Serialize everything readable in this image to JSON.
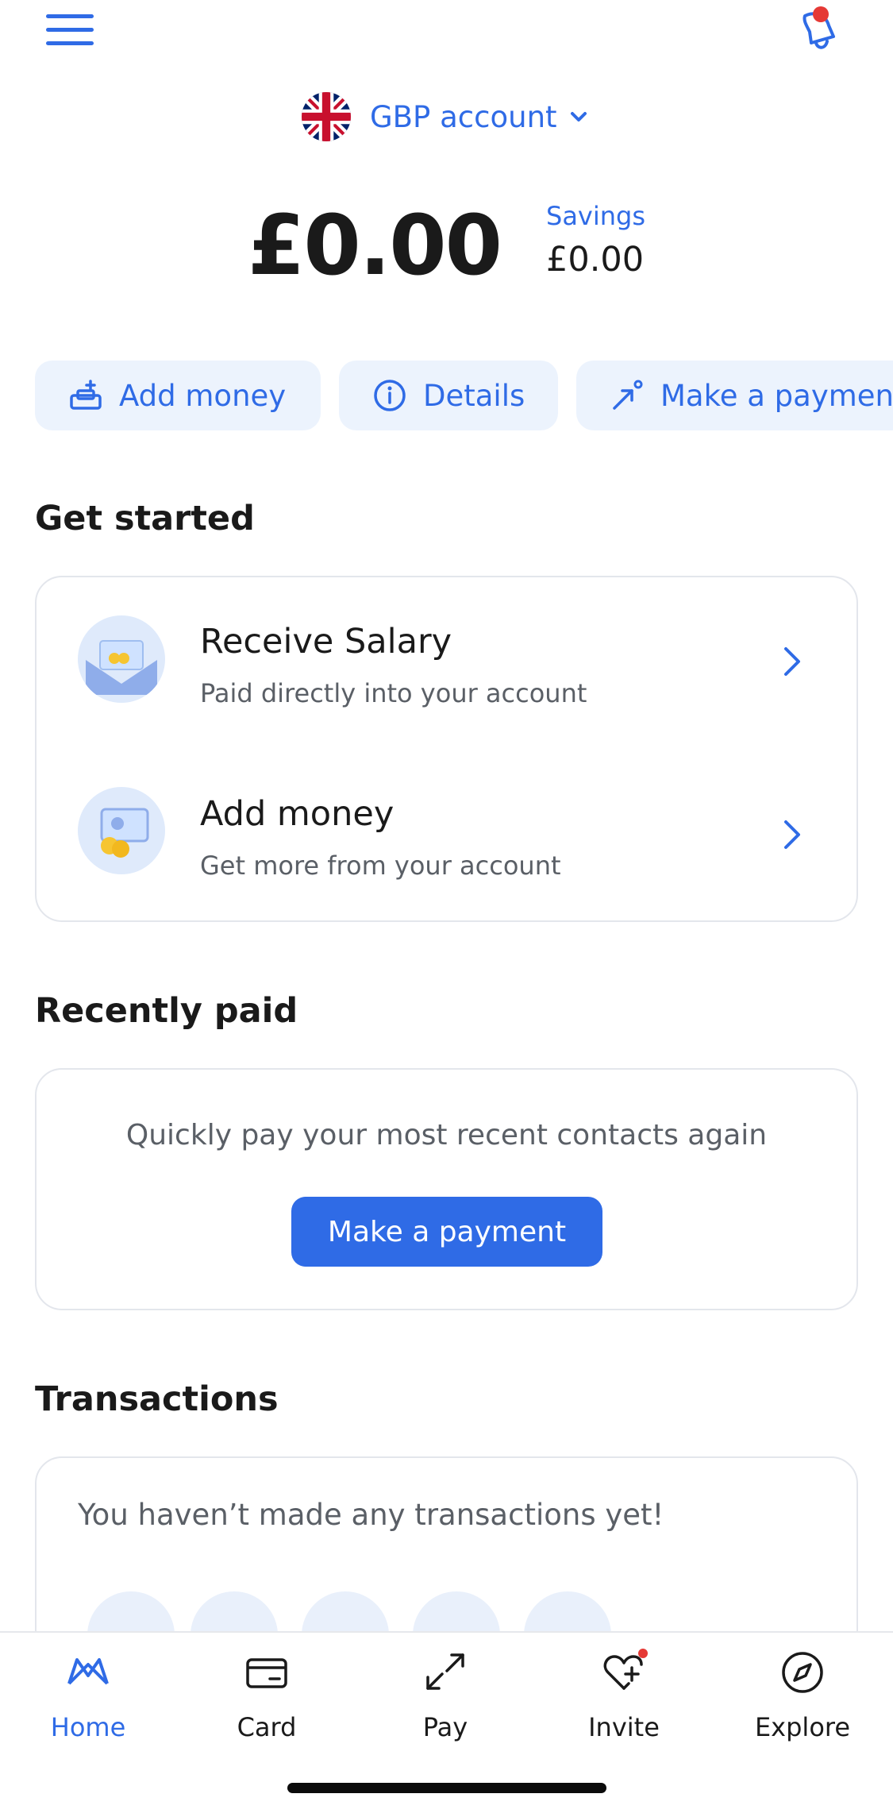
{
  "header": {
    "menu_icon": "hamburger-menu-icon",
    "notifications_icon": "bell-icon",
    "notifications_badge_color": "#e53935"
  },
  "account": {
    "flag_icon": "uk-flag-icon",
    "label": "GBP account",
    "chevron_icon": "chevron-down-icon"
  },
  "balance": {
    "amount": "£0.00",
    "savings_label": "Savings",
    "savings_amount": "£0.00"
  },
  "actions": [
    {
      "label": "Add money",
      "icon": "add-money-icon"
    },
    {
      "label": "Details",
      "icon": "info-icon"
    },
    {
      "label": "Make a payment",
      "icon": "send-arrow-icon"
    }
  ],
  "get_started": {
    "heading": "Get started",
    "items": [
      {
        "title": "Receive Salary",
        "subtitle": "Paid directly into your account",
        "icon": "salary-envelope-icon"
      },
      {
        "title": "Add money",
        "subtitle": "Get more from your account",
        "icon": "cash-coins-icon"
      }
    ]
  },
  "recently_paid": {
    "heading": "Recently paid",
    "text": "Quickly pay your most recent contacts again",
    "button_label": "Make a payment"
  },
  "transactions": {
    "heading": "Transactions",
    "empty_text": "You haven’t made any transactions yet!"
  },
  "nav": {
    "items": [
      {
        "label": "Home",
        "icon": "home-logo-icon",
        "active": true
      },
      {
        "label": "Card",
        "icon": "card-icon",
        "active": false
      },
      {
        "label": "Pay",
        "icon": "pay-arrows-icon",
        "active": false
      },
      {
        "label": "Invite",
        "icon": "heart-plus-icon",
        "active": false
      },
      {
        "label": "Explore",
        "icon": "compass-icon",
        "active": false
      }
    ]
  },
  "colors": {
    "accent": "#2f6be6",
    "pill_bg": "#ecf3fd",
    "badge": "#e53935"
  }
}
